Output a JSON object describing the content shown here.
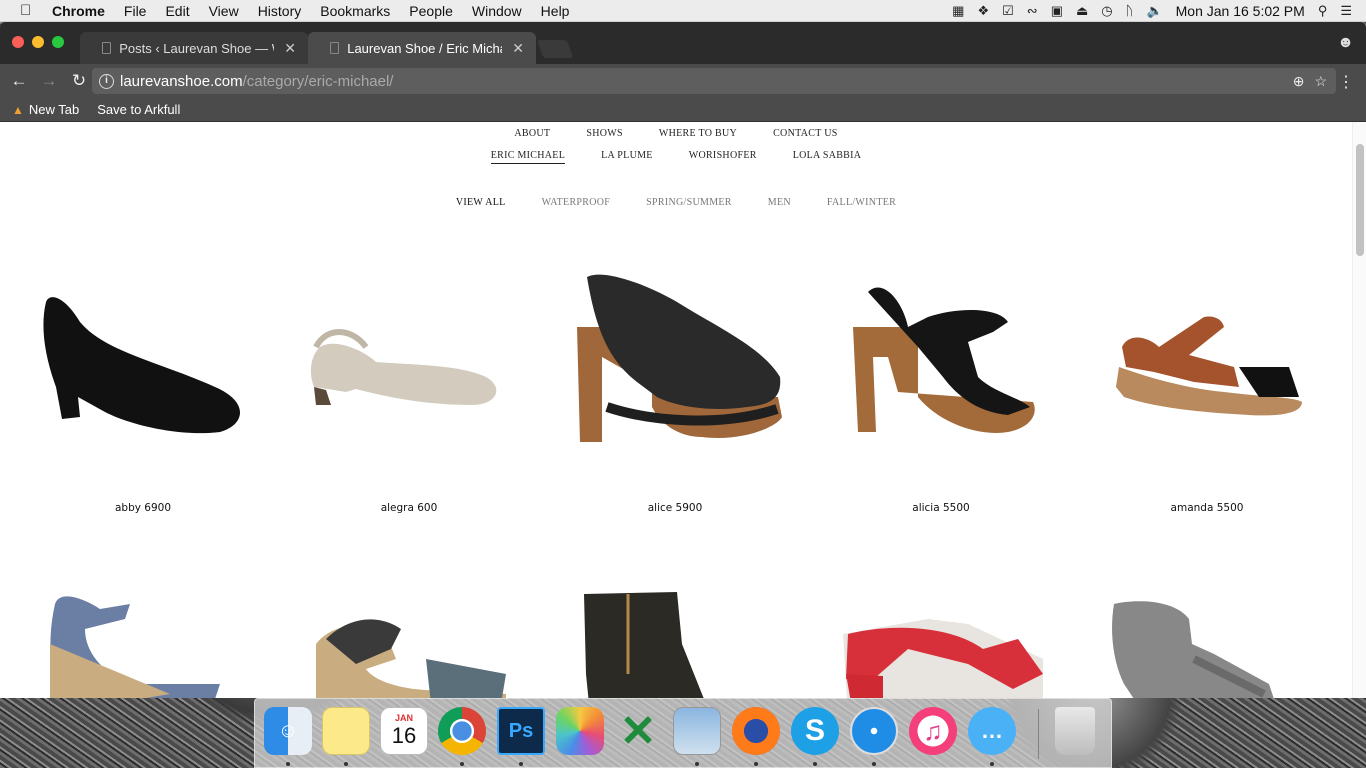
{
  "menubar": {
    "app_name": "Chrome",
    "items": [
      "File",
      "Edit",
      "View",
      "History",
      "Bookmarks",
      "People",
      "Window",
      "Help"
    ],
    "clock": "Mon Jan 16  5:02 PM"
  },
  "tabs": [
    {
      "title": "Posts ‹ Laurevan Shoe — Word"
    },
    {
      "title": "Laurevan Shoe / Eric Michael"
    }
  ],
  "omnibox": {
    "host": "laurevanshoe.com",
    "path": "/category/eric-michael/"
  },
  "bookmarks": [
    {
      "label": "New Tab",
      "icon": "fire-icon"
    },
    {
      "label": "Save to Arkfull",
      "icon": "page-icon"
    }
  ],
  "site_nav": [
    "ABOUT",
    "SHOWS",
    "WHERE TO BUY",
    "CONTACT US"
  ],
  "brand_nav": {
    "items": [
      "ERIC MICHAEL",
      "LA PLUME",
      "WORISHOFER",
      "LOLA SABBIA"
    ],
    "active": "ERIC MICHAEL"
  },
  "filter_nav": {
    "items": [
      "VIEW ALL",
      "WATERPROOF",
      "SPRING/SUMMER",
      "MEN",
      "FALL/WINTER"
    ],
    "active": "VIEW ALL"
  },
  "products": [
    {
      "name": "abby 6900",
      "color": "#111111"
    },
    {
      "name": "alegra 600",
      "color": "#d3cbbd"
    },
    {
      "name": "alice 5900",
      "color": "#2a2a2a"
    },
    {
      "name": "alicia 5500",
      "color": "#151515"
    },
    {
      "name": "amanda 5500",
      "color": "#a4532c"
    }
  ],
  "products_row2": [
    {
      "color": "#6b7ea3"
    },
    {
      "color": "#3a3a3a"
    },
    {
      "color": "#2c2a25"
    },
    {
      "color": "#d8303a"
    },
    {
      "color": "#888888"
    }
  ],
  "dock": {
    "calendar_month": "JAN",
    "calendar_day": "16",
    "ps_label": "Ps"
  }
}
